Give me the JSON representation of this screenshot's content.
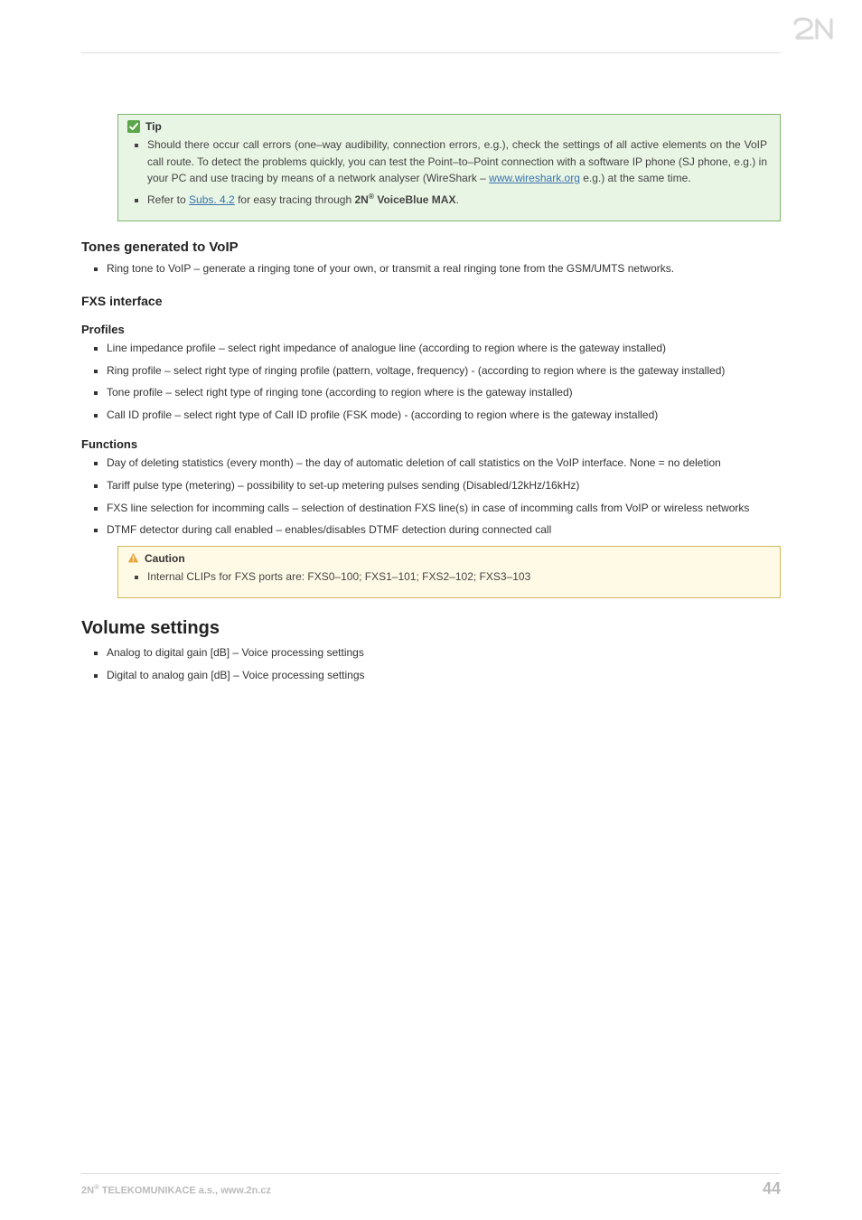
{
  "logo_text": "2N",
  "tip": {
    "title": "Tip",
    "items": [
      "Should there occur call errors (one–way audibility, connection errors, e.g.), check the settings of all active elements on the VoIP call route. To detect the problems quickly, you can test the Point–to–Point connection with a software IP phone (SJ phone, e.g.) in your PC and use tracing by means of a network analyser (WireShark – ",
      "www.wireshark.org",
      " e.g.) at the same time.",
      "Refer to ",
      "Subs. 4.2",
      " for easy tracing through ",
      "2N",
      "®",
      " VoiceBlue MAX",
      "."
    ]
  },
  "tones_heading": "Tones generated to VoIP",
  "tones_item": "Ring tone to VoIP – generate a ringing tone of your own, or transmit a real ringing tone from the GSM/UMTS networks.",
  "fxs_heading": "FXS interface",
  "profiles_heading": "Profiles",
  "profiles_items": [
    "Line impedance profile – select right impedance of analogue line (according to region where is the gateway installed)",
    "Ring profile – select right type of ringing profile (pattern, voltage, frequency) - (according to region where is the gateway installed)",
    "Tone profile – select right type of ringing tone (according to region where is the gateway installed)",
    "Call ID profile –  select right type of Call ID profile (FSK mode) - (according to region where is the gateway installed)"
  ],
  "functions_heading": "Functions",
  "functions_items": [
    "Day of deleting statistics (every month) – the day of automatic deletion of call statistics on the VoIP interface. None = no deletion",
    "Tariff pulse type (metering) – possibility to set-up metering pulses sending (Disabled/12kHz/16kHz)",
    "FXS line selection for incomming calls – selection of destination FXS line(s) in case of incomming calls from VoIP or wireless networks",
    "DTMF detector during call enabled – enables/disables DTMF detection during connected call"
  ],
  "caution": {
    "title": "Caution",
    "item": "Internal CLIPs for FXS ports are: FXS0–100; FXS1–101; FXS2–102; FXS3–103"
  },
  "volume_heading": "Volume settings",
  "volume_items": [
    "Analog to digital gain [dB] – Voice processing settings",
    "Digital to analog gain [dB] – Voice processing settings"
  ],
  "footer": {
    "company_prefix": "2N",
    "reg": "®",
    "company_suffix": " TELEKOMUNIKACE a.s., www.2n.cz",
    "page": "44"
  }
}
